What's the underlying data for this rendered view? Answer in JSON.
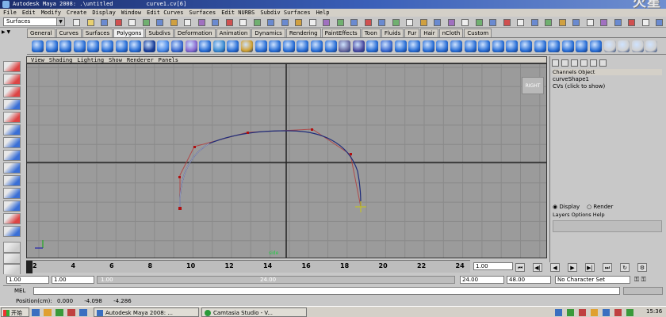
{
  "window": {
    "title": "Autodesk Maya 2008: .\\untitled",
    "file_title": "curve1.cv[6]",
    "watermark": "火星"
  },
  "menubar": [
    "File",
    "Edit",
    "Modify",
    "Create",
    "Display",
    "Window",
    "Edit Curves",
    "Surfaces",
    "Edit NURBS",
    "Subdiv Surfaces",
    "Help"
  ],
  "statusline": {
    "mode": "Surfaces"
  },
  "shelf_tabs": [
    "General",
    "Curves",
    "Surfaces",
    "Polygons",
    "Subdivs",
    "Deformation",
    "Animation",
    "Dynamics",
    "Rendering",
    "PaintEffects",
    "Toon",
    "Fluids",
    "Fur",
    "Hair",
    "nCloth",
    "Custom"
  ],
  "active_shelf_tab": "Polygons",
  "panel_menu": [
    "View",
    "Shading",
    "Lighting",
    "Show",
    "Renderer",
    "Panels"
  ],
  "viewport": {
    "view_cube_label": "RIGHT",
    "camera_name": "side"
  },
  "channel_box": {
    "tabs": [
      "Channels",
      "Object"
    ],
    "object_name": "curveShape1",
    "cvs_label": "CVs (click to show)"
  },
  "layer_editor": {
    "display_label": "Display",
    "render_label": "Render",
    "menu": [
      "Layers",
      "Options",
      "Help"
    ]
  },
  "time_slider": {
    "ticks": [
      "2",
      "4",
      "6",
      "8",
      "10",
      "12",
      "14",
      "16",
      "18",
      "20",
      "22",
      "24"
    ],
    "current_frame": "1.00"
  },
  "range": {
    "start": "1.00",
    "playback_start": "1.00",
    "range_start_label": "1.00",
    "range_end_label": "24.00",
    "playback_end": "24.00",
    "end": "48.00",
    "character_set": "No Character Set"
  },
  "mel_label": "MEL",
  "help_line": {
    "label": "Position(cm):",
    "x": "0.000",
    "y": "-4.098",
    "z": "-4.286"
  },
  "taskbar": {
    "start": "开始",
    "tasks": [
      "Autodesk Maya 2008: ...",
      "Camtasia Studio - V..."
    ],
    "clock": "15:36"
  }
}
